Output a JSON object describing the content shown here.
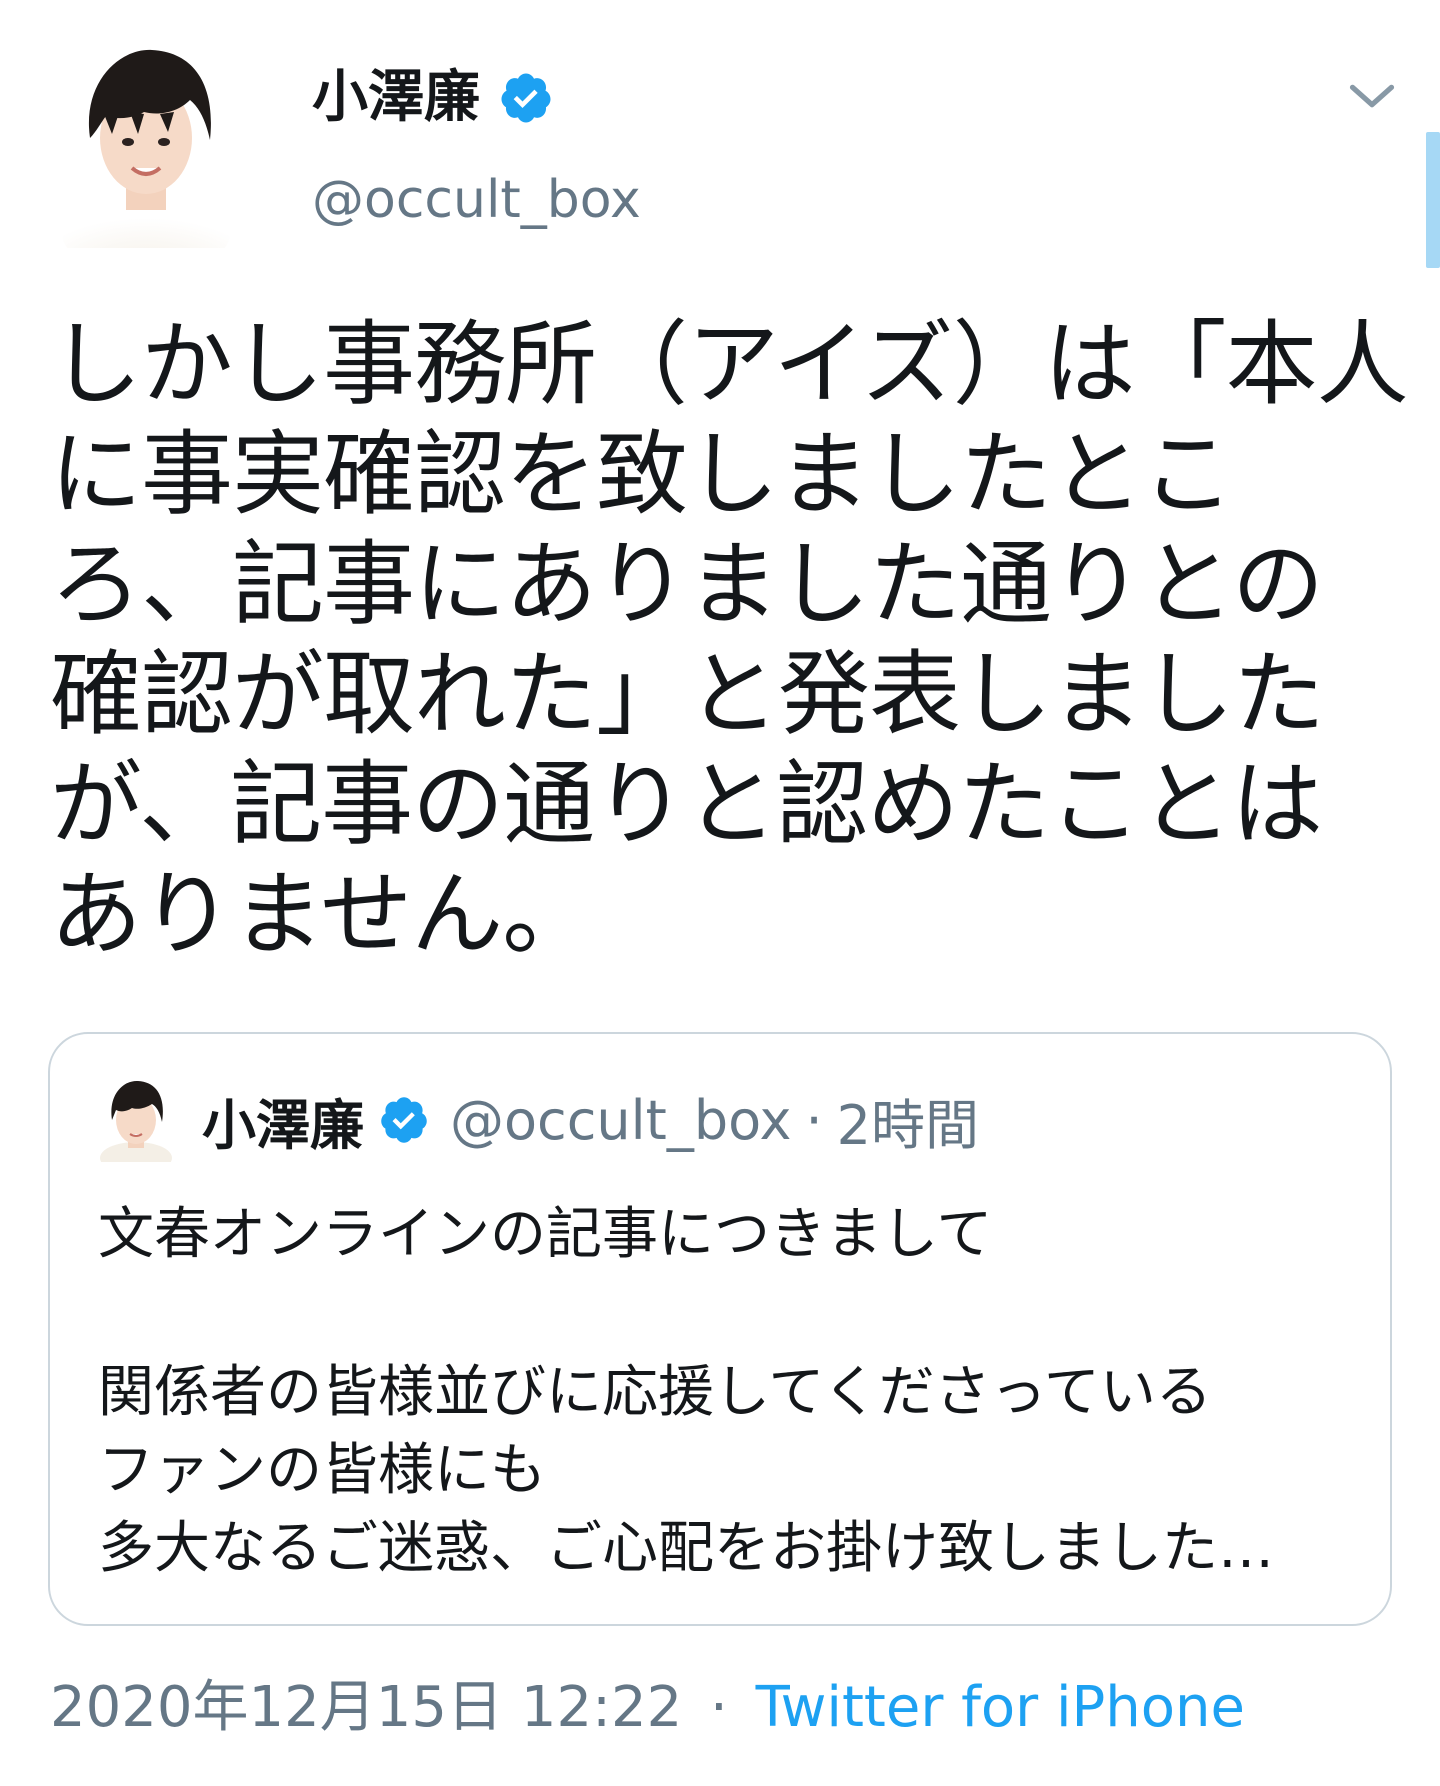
{
  "author": {
    "display_name": "小澤廉",
    "handle": "@occult_box",
    "verified": true
  },
  "tweet": {
    "text": "しかし事務所（アイズ）は「本人に事実確認を致しましたところ、記事にありました通りとの確認が取れた」と発表しましたが、記事の通りと認めたことはありません。"
  },
  "quoted_tweet": {
    "display_name": "小澤廉",
    "handle": "@occult_box",
    "separator": "·",
    "time": "2時間",
    "lines": [
      "文春オンラインの記事につきまして",
      "",
      "関係者の皆様並びに応援してくださっている",
      "ファンの皆様にも",
      "多大なるご迷惑、ご心配をお掛け致しました…"
    ]
  },
  "meta": {
    "datetime": "2020年12月15日 12:22",
    "separator": "·",
    "source": "Twitter for iPhone"
  },
  "colors": {
    "verified_blue": "#1da1f2",
    "secondary_text": "#657786",
    "border": "#ccd6dd",
    "scroll_indicator": "#a6d8f5"
  },
  "icons": [
    "verified-badge-icon",
    "chevron-down-icon"
  ]
}
